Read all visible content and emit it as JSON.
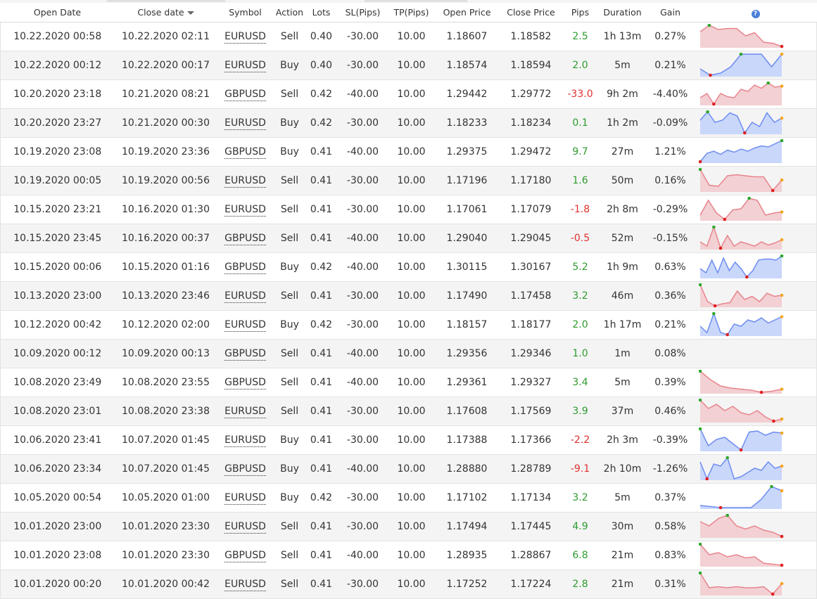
{
  "header": {
    "open_date": "Open Date",
    "close_date": "Close date",
    "symbol": "Symbol",
    "action": "Action",
    "lots": "Lots",
    "sl": "SL(Pips)",
    "tp": "TP(Pips)",
    "open_price": "Open Price",
    "close_price": "Close Price",
    "pips": "Pips",
    "duration": "Duration",
    "gain": "Gain",
    "help": "?"
  },
  "colors": {
    "positive": "#2e9b2e",
    "negative": "#e03030",
    "sell_fill": "#f2d0d3",
    "sell_line": "#e8848c",
    "buy_fill": "#c9d7fb",
    "buy_line": "#6d8cf0"
  },
  "rows": [
    {
      "open_date": "10.22.2020 00:58",
      "close_date": "10.22.2020 02:11",
      "symbol": "EURUSD",
      "action": "Sell",
      "lots": "0.40",
      "sl": "-30.00",
      "tp": "10.00",
      "open_price": "1.18607",
      "close_price": "1.18582",
      "pips": "2.5",
      "duration": "1h 13m",
      "gain": "0.27%",
      "spark": [
        0.7,
        1,
        0.8,
        0.85,
        0.85,
        0.5,
        0.65,
        0.2,
        0.15,
        0
      ]
    },
    {
      "open_date": "10.22.2020 00:12",
      "close_date": "10.22.2020 00:17",
      "symbol": "EURUSD",
      "action": "Buy",
      "lots": "0.40",
      "sl": "-30.00",
      "tp": "10.00",
      "open_price": "1.18574",
      "close_price": "1.18594",
      "pips": "2.0",
      "duration": "5m",
      "gain": "0.21%",
      "spark": [
        0.3,
        0,
        0.1,
        0.4,
        1,
        1,
        1,
        0.4,
        1
      ]
    },
    {
      "open_date": "10.20.2020 23:18",
      "close_date": "10.21.2020 08:21",
      "symbol": "GBPUSD",
      "action": "Sell",
      "lots": "0.42",
      "sl": "-40.00",
      "tp": "10.00",
      "open_price": "1.29442",
      "close_price": "1.29772",
      "pips": "-33.0",
      "duration": "9h 2m",
      "gain": "-4.40%",
      "spark": [
        0.3,
        0.5,
        0,
        0.5,
        0.35,
        0.3,
        0.7,
        0.6,
        0.9,
        0.75,
        1,
        0.8,
        0.85
      ]
    },
    {
      "open_date": "10.20.2020 23:27",
      "close_date": "10.21.2020 00:30",
      "symbol": "EURUSD",
      "action": "Buy",
      "lots": "0.42",
      "sl": "-30.00",
      "tp": "10.00",
      "open_price": "1.18233",
      "close_price": "1.18234",
      "pips": "0.1",
      "duration": "1h 2m",
      "gain": "-0.09%",
      "spark": [
        0.6,
        1,
        0.5,
        0.6,
        0.95,
        0.8,
        0,
        0.5,
        0.3,
        0.95,
        0.5,
        0.7
      ]
    },
    {
      "open_date": "10.19.2020 23:08",
      "close_date": "10.19.2020 23:36",
      "symbol": "GBPUSD",
      "action": "Buy",
      "lots": "0.41",
      "sl": "-40.00",
      "tp": "10.00",
      "open_price": "1.29375",
      "close_price": "1.29472",
      "pips": "9.7",
      "duration": "27m",
      "gain": "1.21%",
      "spark": [
        0,
        0.4,
        0.5,
        0.35,
        0.55,
        0.45,
        0.6,
        0.5,
        0.65,
        0.75,
        0.7,
        0.85,
        1
      ]
    },
    {
      "open_date": "10.19.2020 00:05",
      "close_date": "10.19.2020 00:56",
      "symbol": "EURUSD",
      "action": "Sell",
      "lots": "0.41",
      "sl": "-30.00",
      "tp": "10.00",
      "open_price": "1.17196",
      "close_price": "1.17180",
      "pips": "1.6",
      "duration": "50m",
      "gain": "0.16%",
      "spark": [
        1,
        0.25,
        0.2,
        0.7,
        0.75,
        0.7,
        0.65,
        0.65,
        0,
        0.5
      ]
    },
    {
      "open_date": "10.15.2020 23:21",
      "close_date": "10.16.2020 01:30",
      "symbol": "EURUSD",
      "action": "Sell",
      "lots": "0.41",
      "sl": "-30.00",
      "tp": "10.00",
      "open_price": "1.17061",
      "close_price": "1.17079",
      "pips": "-1.8",
      "duration": "2h 8m",
      "gain": "-0.29%",
      "spark": [
        0.2,
        0.9,
        0.3,
        0,
        0.45,
        0.5,
        1,
        0.9,
        0.2,
        0.3,
        0.35
      ]
    },
    {
      "open_date": "10.15.2020 23:45",
      "close_date": "10.16.2020 00:37",
      "symbol": "GBPUSD",
      "action": "Sell",
      "lots": "0.41",
      "sl": "-40.00",
      "tp": "10.00",
      "open_price": "1.29040",
      "close_price": "1.29045",
      "pips": "-0.5",
      "duration": "52m",
      "gain": "-0.15%",
      "spark": [
        0.3,
        0.1,
        1,
        0,
        0.6,
        0.1,
        0.3,
        0.2,
        0.1,
        0.3,
        0.15,
        0.25,
        0.4
      ]
    },
    {
      "open_date": "10.15.2020 00:06",
      "close_date": "10.15.2020 01:16",
      "symbol": "GBPUSD",
      "action": "Buy",
      "lots": "0.42",
      "sl": "-40.00",
      "tp": "10.00",
      "open_price": "1.30115",
      "close_price": "1.30167",
      "pips": "5.2",
      "duration": "1h 9m",
      "gain": "0.63%",
      "spark": [
        0.4,
        0.2,
        0.8,
        0.2,
        0.9,
        0.3,
        0.7,
        0.4,
        0,
        0.3,
        0.8,
        0.85,
        0.85,
        0.8,
        1
      ]
    },
    {
      "open_date": "10.13.2020 23:00",
      "close_date": "10.13.2020 23:46",
      "symbol": "EURUSD",
      "action": "Sell",
      "lots": "0.41",
      "sl": "-30.00",
      "tp": "10.00",
      "open_price": "1.17490",
      "close_price": "1.17458",
      "pips": "3.2",
      "duration": "46m",
      "gain": "0.36%",
      "spark": [
        1,
        0.2,
        0,
        0.1,
        0.15,
        0.7,
        0.3,
        0.45,
        0.2,
        0.6,
        0.45,
        0.5
      ]
    },
    {
      "open_date": "10.12.2020 00:42",
      "close_date": "10.12.2020 02:00",
      "symbol": "EURUSD",
      "action": "Buy",
      "lots": "0.42",
      "sl": "-30.00",
      "tp": "10.00",
      "open_price": "1.18157",
      "close_price": "1.18177",
      "pips": "2.0",
      "duration": "1h 17m",
      "gain": "0.21%",
      "spark": [
        0.4,
        0.1,
        1,
        0.1,
        0,
        0.5,
        0.4,
        0.7,
        0.6,
        0.8,
        0.55,
        0.7,
        0.85
      ]
    },
    {
      "open_date": "10.09.2020 00:12",
      "close_date": "10.09.2020 00:13",
      "symbol": "GBPUSD",
      "action": "Sell",
      "lots": "0.41",
      "sl": "-40.00",
      "tp": "10.00",
      "open_price": "1.29356",
      "close_price": "1.29346",
      "pips": "1.0",
      "duration": "1m",
      "gain": "0.08%",
      "spark": []
    },
    {
      "open_date": "10.08.2020 23:49",
      "close_date": "10.08.2020 23:55",
      "symbol": "GBPUSD",
      "action": "Sell",
      "lots": "0.41",
      "sl": "-40.00",
      "tp": "10.00",
      "open_price": "1.29361",
      "close_price": "1.29327",
      "pips": "3.4",
      "duration": "5m",
      "gain": "0.39%",
      "spark": [
        1,
        0.6,
        0.3,
        0.2,
        0.15,
        0.1,
        0,
        0.05,
        0.15
      ]
    },
    {
      "open_date": "10.08.2020 23:01",
      "close_date": "10.08.2020 23:38",
      "symbol": "EURUSD",
      "action": "Sell",
      "lots": "0.41",
      "sl": "-30.00",
      "tp": "10.00",
      "open_price": "1.17608",
      "close_price": "1.17569",
      "pips": "3.9",
      "duration": "37m",
      "gain": "0.46%",
      "spark": [
        1,
        0.6,
        0.8,
        0.5,
        0.7,
        0.4,
        0.3,
        0.5,
        0.2,
        0,
        0.1
      ]
    },
    {
      "open_date": "10.06.2020 23:41",
      "close_date": "10.07.2020 01:45",
      "symbol": "EURUSD",
      "action": "Buy",
      "lots": "0.41",
      "sl": "-30.00",
      "tp": "10.00",
      "open_price": "1.17388",
      "close_price": "1.17366",
      "pips": "-2.2",
      "duration": "2h 3m",
      "gain": "-0.39%",
      "spark": [
        1,
        0.2,
        0.5,
        0.6,
        0.3,
        0,
        0.85,
        0.9,
        0.7,
        0.85,
        0.8
      ]
    },
    {
      "open_date": "10.06.2020 23:34",
      "close_date": "10.07.2020 01:45",
      "symbol": "GBPUSD",
      "action": "Buy",
      "lots": "0.41",
      "sl": "-40.00",
      "tp": "10.00",
      "open_price": "1.28880",
      "close_price": "1.28789",
      "pips": "-9.1",
      "duration": "2h 10m",
      "gain": "-1.26%",
      "spark": [
        0.8,
        0,
        0.7,
        0.6,
        1,
        0,
        0.1,
        0.3,
        0.5,
        0.4,
        0.8,
        0.5,
        0.6
      ]
    },
    {
      "open_date": "10.05.2020 00:54",
      "close_date": "10.05.2020 01:00",
      "symbol": "EURUSD",
      "action": "Buy",
      "lots": "0.42",
      "sl": "-30.00",
      "tp": "10.00",
      "open_price": "1.17102",
      "close_price": "1.17134",
      "pips": "3.2",
      "duration": "5m",
      "gain": "0.37%",
      "spark": [
        0.1,
        0.05,
        0,
        0,
        0,
        0,
        0.4,
        1,
        0.8
      ]
    },
    {
      "open_date": "10.01.2020 23:00",
      "close_date": "10.01.2020 23:30",
      "symbol": "EURUSD",
      "action": "Sell",
      "lots": "0.41",
      "sl": "-30.00",
      "tp": "10.00",
      "open_price": "1.17494",
      "close_price": "1.17445",
      "pips": "4.9",
      "duration": "30m",
      "gain": "0.58%",
      "spark": [
        0.7,
        0.5,
        0.85,
        1,
        0.5,
        0.35,
        0.5,
        0.3,
        0.2,
        0
      ]
    },
    {
      "open_date": "10.01.2020 23:08",
      "close_date": "10.01.2020 23:30",
      "symbol": "GBPUSD",
      "action": "Sell",
      "lots": "0.41",
      "sl": "-40.00",
      "tp": "10.00",
      "open_price": "1.28935",
      "close_price": "1.28867",
      "pips": "6.8",
      "duration": "21m",
      "gain": "0.83%",
      "spark": [
        1,
        0.5,
        0.6,
        0.4,
        0.5,
        0.35,
        0.4,
        0.1,
        0.05,
        0
      ]
    },
    {
      "open_date": "10.01.2020 00:20",
      "close_date": "10.01.2020 00:42",
      "symbol": "EURUSD",
      "action": "Sell",
      "lots": "0.41",
      "sl": "-30.00",
      "tp": "10.00",
      "open_price": "1.17252",
      "close_price": "1.17224",
      "pips": "2.8",
      "duration": "21m",
      "gain": "0.31%",
      "spark": [
        1,
        0.3,
        0.35,
        0.3,
        0.35,
        0.3,
        0.3,
        0.35,
        0,
        0.5
      ]
    }
  ]
}
